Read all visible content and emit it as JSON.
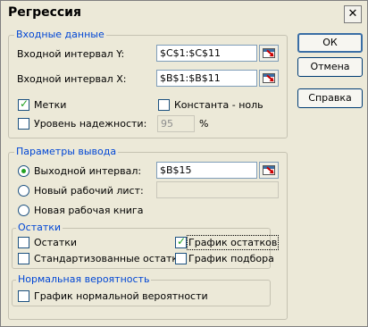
{
  "title": "Регрессия",
  "close_glyph": "✕",
  "input_group": {
    "legend": "Входные данные",
    "y_label": "Входной интервал Y:",
    "y_value": "$C$1:$C$11",
    "x_label": "Входной интервал X:",
    "x_value": "$B$1:$B$11",
    "labels_checkbox": "Метки",
    "labels_checked": true,
    "const_checkbox": "Константа - ноль",
    "const_checked": false,
    "conf_checkbox": "Уровень надежности:",
    "conf_checked": false,
    "conf_value": "95",
    "conf_unit": "%"
  },
  "output_group": {
    "legend": "Параметры вывода",
    "out_range_label": "Выходной интервал:",
    "out_range_value": "$B$15",
    "new_sheet_label": "Новый рабочий лист:",
    "new_sheet_value": "",
    "new_book_label": "Новая рабочая книга",
    "selected": "out_range"
  },
  "residuals_group": {
    "legend": "Остатки",
    "residuals": "Остатки",
    "residuals_checked": false,
    "std_residuals": "Стандартизованные остатки",
    "std_residuals_checked": false,
    "residual_plot": "График остатков",
    "residual_plot_checked": true,
    "fit_plot": "График подбора",
    "fit_plot_checked": false
  },
  "normal_group": {
    "legend": "Нормальная вероятность",
    "normal_plot": "График нормальной вероятности",
    "normal_plot_checked": false
  },
  "buttons": {
    "ok": "ОК",
    "cancel": "Отмена",
    "help": "Справка"
  }
}
